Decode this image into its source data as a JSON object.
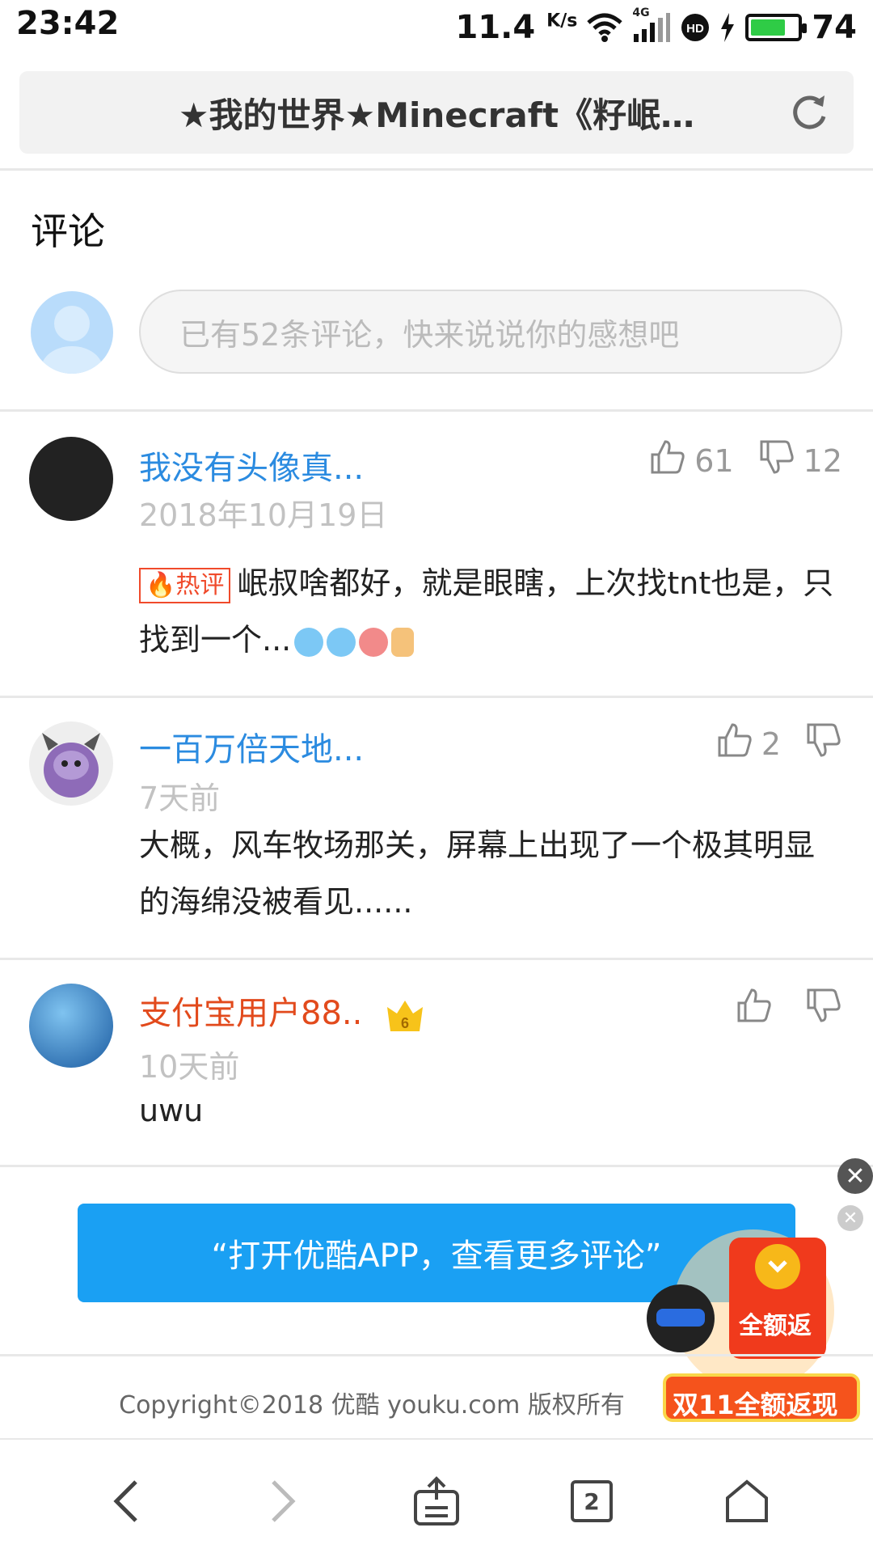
{
  "status": {
    "time": "23:42",
    "speed": "11.4",
    "speed_unit": "K/s",
    "network": "4G",
    "battery": "74",
    "battery_level": 0.74,
    "icons": [
      "wifi-icon",
      "signal-icon",
      "hd-icon",
      "charging-icon",
      "battery-icon"
    ]
  },
  "url_bar": {
    "title": "★我的世界★Minecraft《籽岷…",
    "refresh_icon": "refresh-icon"
  },
  "comments_section": {
    "title": "评论",
    "input_placeholder": "已有52条评论，快来说说你的感想吧"
  },
  "comments": [
    {
      "name": "我没有头像真...",
      "date": "2018年10月19日",
      "hot_label": "热评",
      "text": "岷叔啥都好，就是眼瞎，上次找tnt也是，只找到一个...",
      "likes": "61",
      "dislikes": "12",
      "name_color": "#2b8be0"
    },
    {
      "name": "一百万倍天地...",
      "date": "7天前",
      "text": "大概，风车牧场那关，屏幕上出现了一个极其明显的海绵没被看见......",
      "likes": "2",
      "dislikes": "",
      "name_color": "#2b8be0"
    },
    {
      "name": "支付宝用户88..",
      "level": "6",
      "date": "10天前",
      "text": "uwu",
      "likes": "",
      "dislikes": "",
      "name_color": "#e24a1c"
    }
  ],
  "open_app": {
    "label": "“打开优酷APP，查看更多评论”"
  },
  "promo": {
    "top_text": "全额返",
    "bottom_text": "双11全额返现"
  },
  "footer": {
    "copyright": "Copyright©2018 优酷 youku.com 版权所有"
  },
  "bottom_nav": {
    "tab_count": "2"
  },
  "colors": {
    "accent": "#1aa0f3",
    "link": "#2b8be0",
    "vip_name": "#e24a1c"
  }
}
